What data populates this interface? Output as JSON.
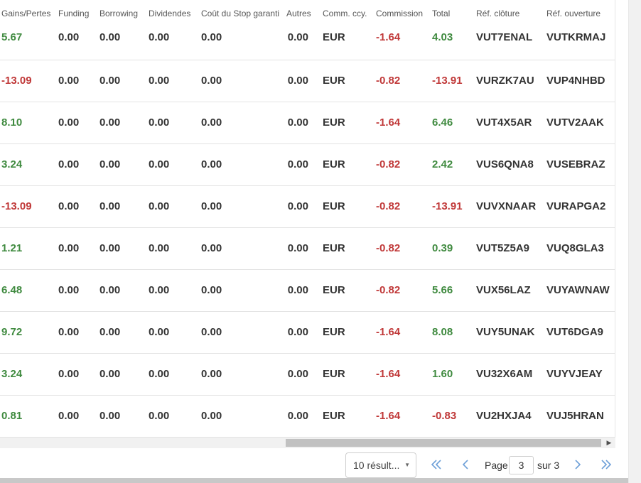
{
  "columns": [
    {
      "key": "gains",
      "label": "Gains/Pertes"
    },
    {
      "key": "funding",
      "label": "Funding"
    },
    {
      "key": "borrowing",
      "label": "Borrowing"
    },
    {
      "key": "dividends",
      "label": "Dividendes"
    },
    {
      "key": "stop",
      "label": "Coût du Stop garanti"
    },
    {
      "key": "others",
      "label": "Autres"
    },
    {
      "key": "ccy",
      "label": "Comm. ccy."
    },
    {
      "key": "commission",
      "label": "Commission"
    },
    {
      "key": "total",
      "label": "Total"
    },
    {
      "key": "ref_close",
      "label": "Réf. clôture"
    },
    {
      "key": "ref_open",
      "label": "Réf. ouverture"
    }
  ],
  "rows": [
    {
      "gains": "5.67",
      "funding": "0.00",
      "borrowing": "0.00",
      "dividends": "0.00",
      "stop": "0.00",
      "others": "0.00",
      "ccy": "EUR",
      "commission": "-1.64",
      "total": "4.03",
      "ref_close": "VUT7ENAL",
      "ref_open": "VUTKRMAJ"
    },
    {
      "gains": "-13.09",
      "funding": "0.00",
      "borrowing": "0.00",
      "dividends": "0.00",
      "stop": "0.00",
      "others": "0.00",
      "ccy": "EUR",
      "commission": "-0.82",
      "total": "-13.91",
      "ref_close": "VURZK7AU",
      "ref_open": "VUP4NHBD"
    },
    {
      "gains": "8.10",
      "funding": "0.00",
      "borrowing": "0.00",
      "dividends": "0.00",
      "stop": "0.00",
      "others": "0.00",
      "ccy": "EUR",
      "commission": "-1.64",
      "total": "6.46",
      "ref_close": "VUT4X5AR",
      "ref_open": "VUTV2AAK"
    },
    {
      "gains": "3.24",
      "funding": "0.00",
      "borrowing": "0.00",
      "dividends": "0.00",
      "stop": "0.00",
      "others": "0.00",
      "ccy": "EUR",
      "commission": "-0.82",
      "total": "2.42",
      "ref_close": "VUS6QNA8",
      "ref_open": "VUSEBRAZ"
    },
    {
      "gains": "-13.09",
      "funding": "0.00",
      "borrowing": "0.00",
      "dividends": "0.00",
      "stop": "0.00",
      "others": "0.00",
      "ccy": "EUR",
      "commission": "-0.82",
      "total": "-13.91",
      "ref_close": "VUVXNAAR",
      "ref_open": "VURAPGA2"
    },
    {
      "gains": "1.21",
      "funding": "0.00",
      "borrowing": "0.00",
      "dividends": "0.00",
      "stop": "0.00",
      "others": "0.00",
      "ccy": "EUR",
      "commission": "-0.82",
      "total": "0.39",
      "ref_close": "VUT5Z5A9",
      "ref_open": "VUQ8GLA3"
    },
    {
      "gains": "6.48",
      "funding": "0.00",
      "borrowing": "0.00",
      "dividends": "0.00",
      "stop": "0.00",
      "others": "0.00",
      "ccy": "EUR",
      "commission": "-0.82",
      "total": "5.66",
      "ref_close": "VUX56LAZ",
      "ref_open": "VUYAWNAW"
    },
    {
      "gains": "9.72",
      "funding": "0.00",
      "borrowing": "0.00",
      "dividends": "0.00",
      "stop": "0.00",
      "others": "0.00",
      "ccy": "EUR",
      "commission": "-1.64",
      "total": "8.08",
      "ref_close": "VUY5UNAK",
      "ref_open": "VUT6DGA9"
    },
    {
      "gains": "3.24",
      "funding": "0.00",
      "borrowing": "0.00",
      "dividends": "0.00",
      "stop": "0.00",
      "others": "0.00",
      "ccy": "EUR",
      "commission": "-1.64",
      "total": "1.60",
      "ref_close": "VU32X6AM",
      "ref_open": "VUYVJEAY"
    },
    {
      "gains": "0.81",
      "funding": "0.00",
      "borrowing": "0.00",
      "dividends": "0.00",
      "stop": "0.00",
      "others": "0.00",
      "ccy": "EUR",
      "commission": "-1.64",
      "total": "-0.83",
      "ref_close": "VU2HXJA4",
      "ref_open": "VUJ5HRAN"
    }
  ],
  "pagination": {
    "page_size_label": "10 résult...",
    "page_label": "Page",
    "current_page": "3",
    "of_label": "sur 3",
    "first_icon": "double-chevron-left-icon",
    "prev_icon": "chevron-left-icon",
    "next_icon": "chevron-right-icon",
    "last_icon": "double-chevron-right-icon"
  },
  "colors": {
    "positive": "#3f8a3f",
    "negative": "#c03838",
    "nav": "#6ea0d8"
  }
}
